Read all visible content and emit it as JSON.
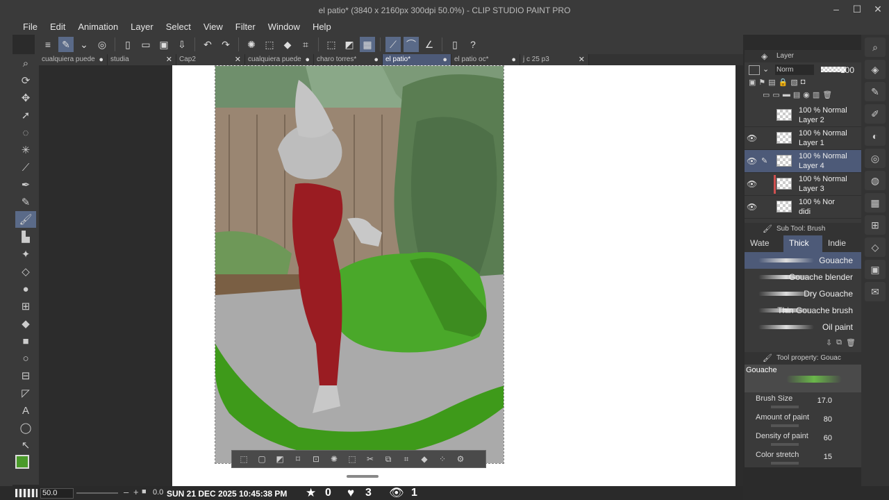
{
  "window": {
    "title": "el patio* (3840 x 2160px 300dpi 50.0%)  - CLIP STUDIO PAINT PRO"
  },
  "menu": [
    "File",
    "Edit",
    "Animation",
    "Layer",
    "Select",
    "View",
    "Filter",
    "Window",
    "Help"
  ],
  "tabs": [
    {
      "label": "cualquiera puede",
      "active": false
    },
    {
      "label": "studia",
      "active": false
    },
    {
      "label": "Cap2",
      "active": false
    },
    {
      "label": "cualquiera puede",
      "active": false
    },
    {
      "label": "charo torres*",
      "active": false
    },
    {
      "label": "el patio*",
      "active": true
    },
    {
      "label": "el patio oc*",
      "active": false
    },
    {
      "label": "j c 25 p3",
      "active": false
    }
  ],
  "layer_panel": {
    "title": "Layer",
    "blend_mode": "Norm",
    "opacity": "100",
    "layers": [
      {
        "line1": "100 % Normal",
        "line2": "Layer 2",
        "visible": false,
        "selected": false
      },
      {
        "line1": "100 % Normal",
        "line2": "Layer 1",
        "visible": true,
        "selected": false
      },
      {
        "line1": "100 % Normal",
        "line2": "Layer 4",
        "visible": true,
        "selected": true
      },
      {
        "line1": "100 % Normal",
        "line2": "Layer 3",
        "visible": true,
        "selected": false
      },
      {
        "line1": "100 % Nor",
        "line2": "didi",
        "visible": true,
        "selected": false
      }
    ]
  },
  "subtool": {
    "title": "Sub Tool: Brush",
    "tabs": [
      "Wate",
      "Thick",
      "Indie"
    ],
    "brushes": [
      {
        "name": "Gouache",
        "selected": true
      },
      {
        "name": "Gouache blender",
        "selected": false
      },
      {
        "name": "Dry Gouache",
        "selected": false
      },
      {
        "name": "Thin Gouache brush",
        "selected": false
      },
      {
        "name": "Oil paint",
        "selected": false
      }
    ]
  },
  "tool_property": {
    "title": "Tool property: Gouac",
    "preview_label": "Gouache",
    "props": [
      {
        "label": "Brush Size",
        "value": "17.0"
      },
      {
        "label": "Amount of paint",
        "value": "80"
      },
      {
        "label": "Density of paint",
        "value": "60"
      },
      {
        "label": "Color stretch",
        "value": "15"
      }
    ]
  },
  "status": {
    "zoom": "50.0",
    "rotation": "0.0",
    "datetime": "SUN 21 DEC 2025 10:45:38 PM",
    "stars": "0",
    "hearts": "3",
    "views": "1"
  },
  "colors": {
    "main_color": "#4a9a2a",
    "sub_color": "#9ccc6a",
    "accent": "#5a6a88"
  }
}
